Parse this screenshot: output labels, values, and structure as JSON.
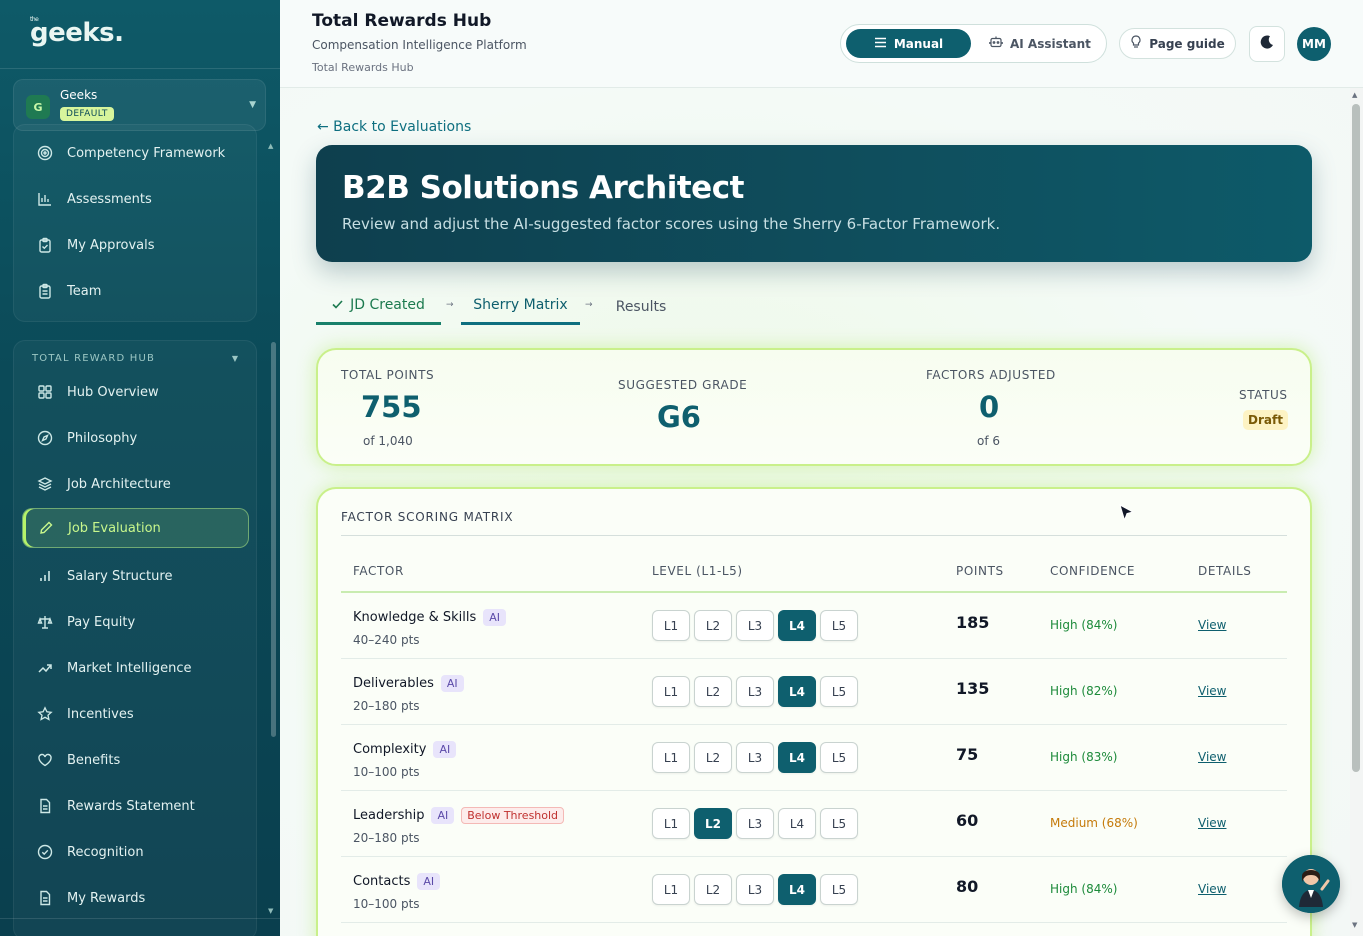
{
  "sidebar": {
    "logo_small": "the",
    "logo": "geeks.",
    "org": {
      "avatar": "G",
      "name": "Geeks",
      "badge": "DEFAULT"
    },
    "top_items": [
      {
        "label": "Competency Framework",
        "icon": "target-icon"
      },
      {
        "label": "Assessments",
        "icon": "bar-chart-icon"
      },
      {
        "label": "My Approvals",
        "icon": "clipboard-check-icon"
      },
      {
        "label": "Team",
        "icon": "clipboard-list-icon"
      }
    ],
    "group_title": "TOTAL REWARD HUB",
    "group_items": [
      {
        "label": "Hub Overview",
        "icon": "grid-icon"
      },
      {
        "label": "Philosophy",
        "icon": "compass-icon"
      },
      {
        "label": "Job Architecture",
        "icon": "layers-icon"
      },
      {
        "label": "Job Evaluation",
        "icon": "pencil-icon",
        "active": true
      },
      {
        "label": "Salary Structure",
        "icon": "signal-bars-icon"
      },
      {
        "label": "Pay Equity",
        "icon": "scale-icon"
      },
      {
        "label": "Market Intelligence",
        "icon": "trending-up-icon"
      },
      {
        "label": "Incentives",
        "icon": "star-icon"
      },
      {
        "label": "Benefits",
        "icon": "heart-icon"
      },
      {
        "label": "Rewards Statement",
        "icon": "document-icon"
      },
      {
        "label": "Recognition",
        "icon": "check-circle-icon"
      },
      {
        "label": "My Rewards",
        "icon": "document-icon"
      }
    ]
  },
  "header": {
    "title": "Total Rewards Hub",
    "subtitle": "Compensation Intelligence Platform",
    "breadcrumb": "Total Rewards Hub",
    "mode_manual": "Manual",
    "mode_ai": "AI Assistant",
    "page_guide": "Page guide",
    "avatar": "MM"
  },
  "main": {
    "back_link": "← Back to Evaluations",
    "hero_title": "B2B Solutions Architect",
    "hero_subtitle": "Review and adjust the AI-suggested factor scores using the Sherry 6-Factor Framework.",
    "tabs": {
      "done": "JD Created",
      "current": "Sherry Matrix",
      "next": "Results",
      "arrow": "→"
    },
    "summary": {
      "total_points_label": "TOTAL POINTS",
      "total_points": "755",
      "total_points_sub": "of 1,040",
      "grade_label": "SUGGESTED GRADE",
      "grade": "G6",
      "adjusted_label": "FACTORS ADJUSTED",
      "adjusted": "0",
      "adjusted_sub": "of 6",
      "status_label": "STATUS",
      "status": "Draft"
    },
    "matrix": {
      "title": "FACTOR SCORING MATRIX",
      "headers": {
        "factor": "FACTOR",
        "level": "LEVEL (L1-L5)",
        "points": "POINTS",
        "confidence": "CONFIDENCE",
        "details": "DETAILS"
      },
      "level_labels": [
        "L1",
        "L2",
        "L3",
        "L4",
        "L5"
      ],
      "ai_label": "AI",
      "view_label": "View",
      "rows": [
        {
          "factor": "Knowledge & Skills",
          "range": "40–240 pts",
          "selected": 4,
          "points": "185",
          "confidence": "High (84%)",
          "confidence_level": "high"
        },
        {
          "factor": "Deliverables",
          "range": "20–180 pts",
          "selected": 4,
          "points": "135",
          "confidence": "High (82%)",
          "confidence_level": "high"
        },
        {
          "factor": "Complexity",
          "range": "10–100 pts",
          "selected": 4,
          "points": "75",
          "confidence": "High (83%)",
          "confidence_level": "high"
        },
        {
          "factor": "Leadership",
          "range": "20–180 pts",
          "selected": 2,
          "points": "60",
          "confidence": "Medium (68%)",
          "confidence_level": "medium",
          "warning": "Below Threshold"
        },
        {
          "factor": "Contacts",
          "range": "10–100 pts",
          "selected": 4,
          "points": "80",
          "confidence": "High (84%)",
          "confidence_level": "high"
        }
      ]
    }
  },
  "colors": {
    "brand": "#0e5f6e",
    "accent": "#c9f08a",
    "sidebar": "#0b4a58",
    "high": "#1c8a3a",
    "medium": "#c57a0a",
    "draft": "#fdf3c4"
  }
}
